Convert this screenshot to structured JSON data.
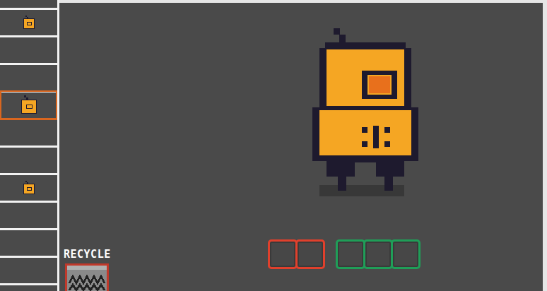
{
  "inventory": {
    "slots": [
      {
        "filled": false,
        "selected": false
      },
      {
        "filled": true,
        "selected": false
      },
      {
        "filled": false,
        "selected": false
      },
      {
        "filled": false,
        "selected": false
      },
      {
        "filled": true,
        "selected": true
      },
      {
        "filled": false,
        "selected": false
      },
      {
        "filled": false,
        "selected": false
      },
      {
        "filled": true,
        "selected": false
      },
      {
        "filled": false,
        "selected": false
      },
      {
        "filled": false,
        "selected": false
      },
      {
        "filled": false,
        "selected": false
      }
    ]
  },
  "recycle": {
    "label": "RECYCLE"
  },
  "part_slots": [
    {
      "filled": false,
      "color": "#e0402c"
    },
    {
      "filled": false,
      "color": "#e0402c"
    },
    {
      "filled": false,
      "color": "#1f9e58"
    },
    {
      "filled": false,
      "color": "#1f9e58"
    },
    {
      "filled": false,
      "color": "#1f9e58"
    }
  ]
}
